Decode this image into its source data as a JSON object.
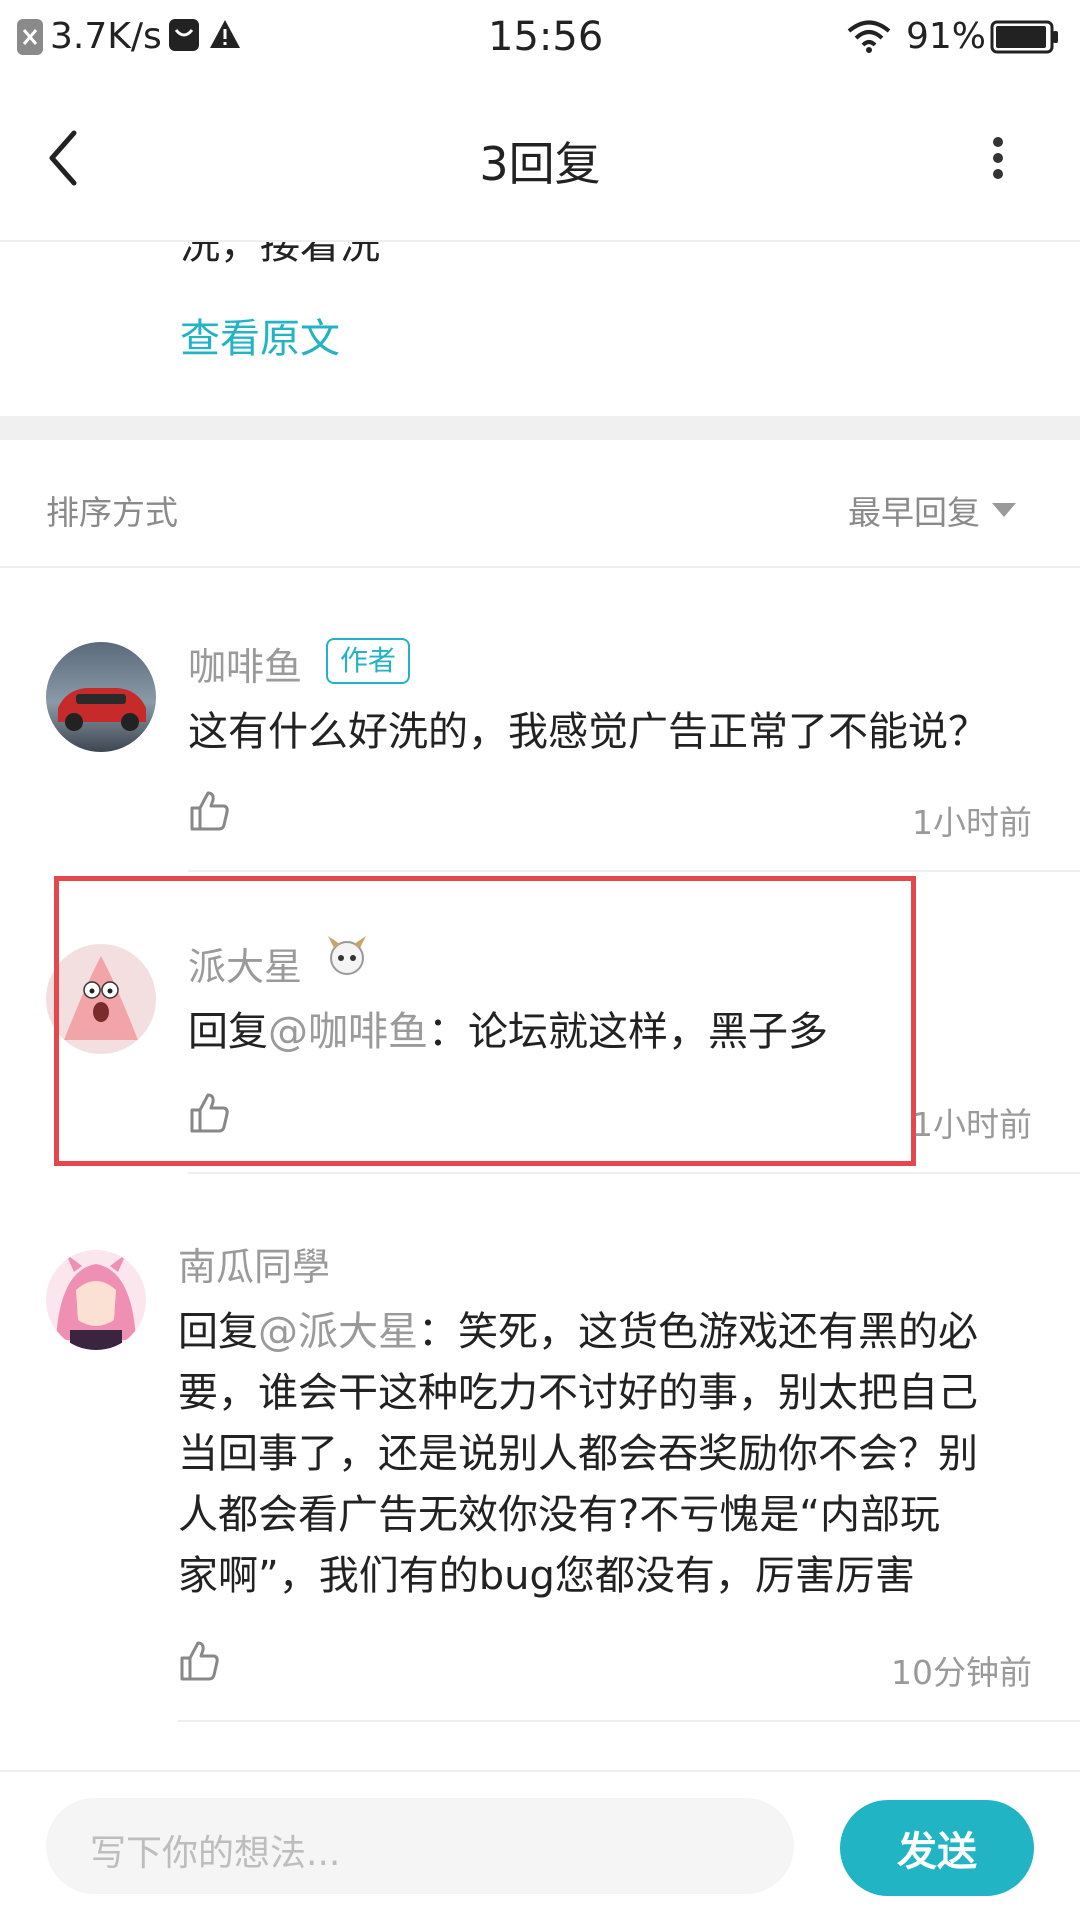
{
  "status_bar": {
    "net_speed": "3.7K/s",
    "time": "15:56",
    "battery": "91%"
  },
  "header": {
    "title": "3回复"
  },
  "original_post": {
    "tail_text": "洗，接着洗",
    "view_original": "查看原文"
  },
  "sort": {
    "label": "排序方式",
    "value": "最早回复"
  },
  "comments": [
    {
      "name": "咖啡鱼",
      "badge": "作者",
      "text": "这有什么好洗的，我感觉广告正常了不能说？",
      "time": "1小时前"
    },
    {
      "name": "派大星",
      "reply_prefix": "回复",
      "mention": "@咖啡鱼",
      "text": "：论坛就这样，黑子多",
      "time": "1小时前"
    },
    {
      "name": "南瓜同學",
      "reply_prefix": "回复",
      "mention": "@派大星",
      "text_line1": "：笑死，这货色游戏还有黑的必",
      "text_lines": [
        "要，谁会干这种吃力不讨好的事，别太把自己",
        "当回事了，还是说别人都会吞奖励你不会？别",
        "人都会看广告无效你没有?不亏愧是“内部玩",
        "家啊”，我们有的bug您都没有，厉害厉害"
      ],
      "time": "10分钟前"
    }
  ],
  "composer": {
    "placeholder": "写下你的想法...",
    "send_label": "发送"
  },
  "colors": {
    "accent": "#20b4c4",
    "highlight": "#e4484d"
  }
}
